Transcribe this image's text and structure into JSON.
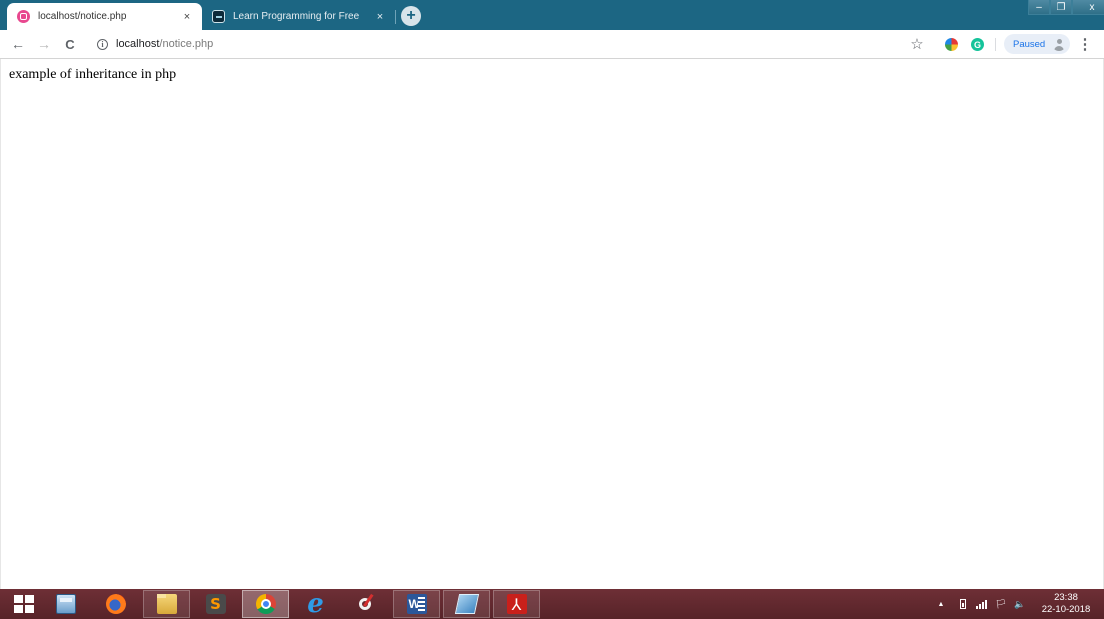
{
  "browser": {
    "tabs": [
      {
        "title": "localhost/notice.php",
        "favicon": "xampp-icon",
        "active": true
      },
      {
        "title": "Learn Programming for Free",
        "favicon": "learn-programming-icon",
        "active": false
      }
    ],
    "tab_close_glyph": "×",
    "new_tab_glyph": "+",
    "window_controls": {
      "minimize": "–",
      "maximize": "❐",
      "close": "x"
    },
    "nav": {
      "back": "←",
      "forward": "→",
      "reload": "C"
    },
    "address": {
      "host": "localhost",
      "path": "/notice.php",
      "info_glyph": "i"
    },
    "bookmark_glyph": "☆",
    "extensions": [
      "colorful-extension-icon",
      "grammarly-icon"
    ],
    "grammarly_glyph": "G",
    "profile": {
      "label": "Paused"
    },
    "menu_glyph": "⋮"
  },
  "page": {
    "text": "example of inheritance in php"
  },
  "taskbar": {
    "apps": [
      "start-button",
      "calculator",
      "firefox",
      "file-explorer",
      "sublime-text",
      "chrome",
      "internet-explorer",
      "snipping-tool",
      "word",
      "notepad",
      "acrobat"
    ],
    "sublime_glyph": "S",
    "ie_glyph": "e",
    "word_glyph": "W",
    "acrobat_glyph": "⅄",
    "tray": {
      "show_hidden": "▲",
      "flag": "🏳",
      "volume": "🔈"
    },
    "clock": {
      "time": "23:38",
      "date": "22-10-2018"
    }
  }
}
